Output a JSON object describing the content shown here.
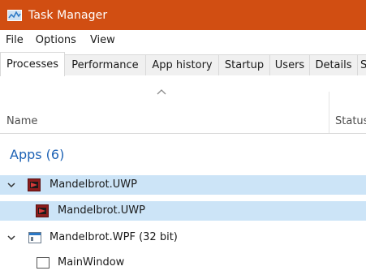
{
  "window": {
    "title": "Task Manager"
  },
  "menu": [
    "File",
    "Options",
    "View"
  ],
  "tabs": [
    {
      "label": "Processes",
      "active": true
    },
    {
      "label": "Performance"
    },
    {
      "label": "App history"
    },
    {
      "label": "Startup"
    },
    {
      "label": "Users"
    },
    {
      "label": "Details"
    },
    {
      "label": "S"
    }
  ],
  "columns": {
    "name": "Name",
    "status": "Status"
  },
  "group": {
    "label": "Apps (6)"
  },
  "processes": [
    {
      "label": "Mandelbrot.UWP",
      "icon": "uwp-app-icon",
      "expanded": true,
      "selected": true
    },
    {
      "label": "Mandelbrot.UWP",
      "icon": "uwp-app-icon",
      "child": true,
      "selected": true
    },
    {
      "label": "Mandelbrot.WPF (32 bit)",
      "icon": "window-app-icon",
      "expanded": true
    },
    {
      "label": "MainWindow",
      "icon": "window-icon",
      "child": true
    }
  ],
  "colors": {
    "titlebar": "#d14e12",
    "selection": "#cce4f7",
    "group_text": "#1d62b5"
  }
}
